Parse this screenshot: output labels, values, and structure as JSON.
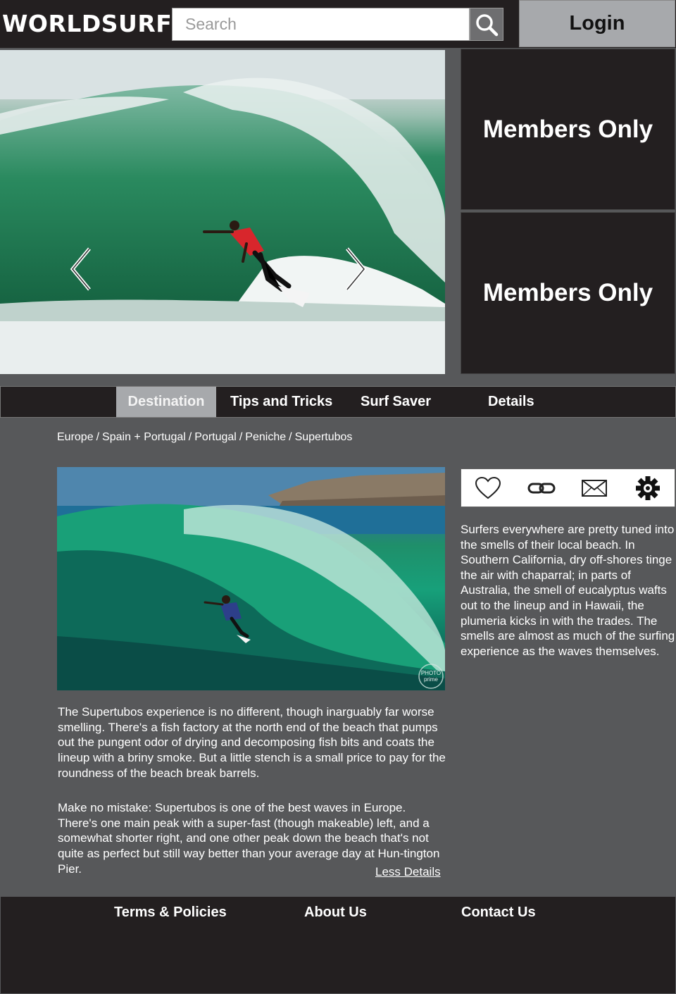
{
  "header": {
    "logo": "WORLDSURF",
    "search_placeholder": "Search",
    "search_icon": "search-icon",
    "login_label": "Login"
  },
  "hero": {
    "prev_icon": "chevron-left-icon",
    "next_icon": "chevron-right-icon",
    "slide_count": 3
  },
  "members": [
    {
      "label": "Members Only"
    },
    {
      "label": "Members Only"
    }
  ],
  "nav": {
    "items": [
      {
        "label": "Destination",
        "active": true
      },
      {
        "label": "Tips and Tricks"
      },
      {
        "label": "Surf Saver"
      },
      {
        "label": "Details"
      }
    ]
  },
  "breadcrumb": {
    "items": [
      "Europe",
      "Spain + Portugal",
      "Portugal",
      "Peniche",
      "Supertubos"
    ],
    "separator": "/"
  },
  "photo": {
    "watermark": "PHOTO prime"
  },
  "actions": {
    "icons": [
      "heart-icon",
      "link-icon",
      "mail-icon",
      "gear-icon"
    ]
  },
  "content": {
    "side_paragraph": "Surfers everywhere are pretty tuned into the smells of their local beach. In Southern California, dry off-shores tinge the air with chaparral; in parts of Australia, the smell of eucalyptus wafts out to the lineup and in Hawaii, the plumeria kicks in with the trades. The smells are almost as much of the surfing experience as the waves themselves.",
    "paragraph_1": "The Supertubos experience is no different, though inarguably far worse smelling. There's a fish factory at the north end of the beach that pumps out the pungent odor of drying and decomposing fish bits and coats the lineup with a briny smoke. But a little stench is a small price to pay for the roundness of the beach break barrels.",
    "paragraph_2": "Make no mistake: Supertubos is one of the best waves in Europe. There's one main peak with a super-fast (though makeable) left, and a somewhat shorter right, and one other peak down the beach that's not quite as perfect but still way better than your average day at Hun-tington Pier.",
    "less_details": "Less Details"
  },
  "footer": {
    "terms": "Terms & Policies",
    "about": "About Us",
    "contact": "Contact Us"
  },
  "colors": {
    "page_bg": "#57585a",
    "dark": "#231f20",
    "active_tab": "#a7a9ac",
    "login_bg": "#a7a9ac"
  }
}
